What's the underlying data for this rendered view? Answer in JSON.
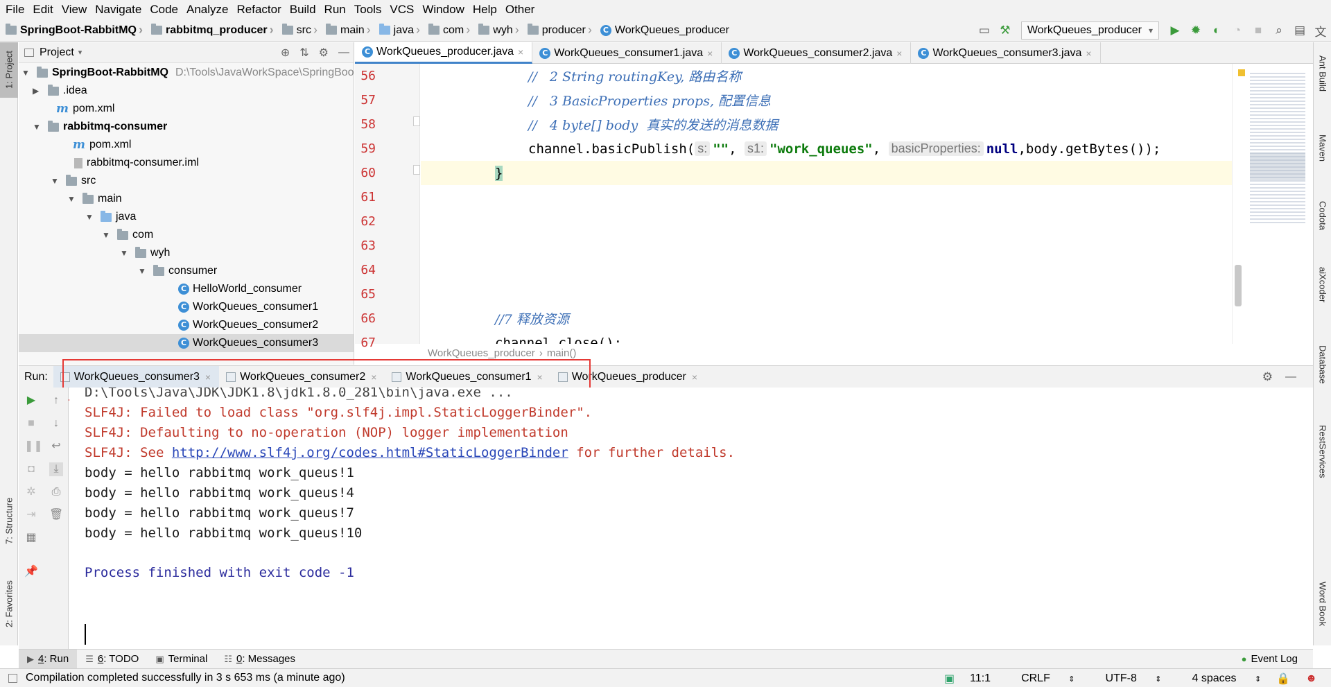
{
  "menu": [
    "File",
    "Edit",
    "View",
    "Navigate",
    "Code",
    "Analyze",
    "Refactor",
    "Build",
    "Run",
    "Tools",
    "VCS",
    "Window",
    "Help",
    "Other"
  ],
  "breadcrumb": [
    "SpringBoot-RabbitMQ",
    "rabbitmq_producer",
    "src",
    "main",
    "java",
    "com",
    "wyh",
    "producer",
    "WorkQueues_producer"
  ],
  "run_config": "WorkQueues_producer",
  "left_strip": {
    "project": "1: Project",
    "structure": "7: Structure",
    "favorites": "2: Favorites"
  },
  "right_strip": [
    "Ant Build",
    "Maven",
    "Codota",
    "aiXcoder",
    "Database",
    "RestServices",
    "Word Book"
  ],
  "project_panel": {
    "title": "Project",
    "tree": [
      {
        "label": "SpringBoot-RabbitMQ",
        "path": "D:\\Tools\\JavaWorkSpace\\SpringBoo"
      },
      {
        "label": ".idea"
      },
      {
        "label": "pom.xml"
      },
      {
        "label": "rabbitmq-consumer"
      },
      {
        "label": "pom.xml"
      },
      {
        "label": "rabbitmq-consumer.iml"
      },
      {
        "label": "src"
      },
      {
        "label": "main"
      },
      {
        "label": "java"
      },
      {
        "label": "com"
      },
      {
        "label": "wyh"
      },
      {
        "label": "consumer"
      },
      {
        "label": "HelloWorld_consumer"
      },
      {
        "label": "WorkQueues_consumer1"
      },
      {
        "label": "WorkQueues_consumer2"
      },
      {
        "label": "WorkQueues_consumer3"
      }
    ]
  },
  "editor_tabs": [
    "WorkQueues_producer.java",
    "WorkQueues_consumer1.java",
    "WorkQueues_consumer2.java",
    "WorkQueues_consumer3.java"
  ],
  "editor": {
    "line_numbers": [
      "56",
      "57",
      "58",
      "59",
      "60",
      "61",
      "62",
      "63",
      "64",
      "65",
      "66",
      "67"
    ],
    "l56": "//   2 String routingKey, 路由名称",
    "l57": "//   3 BasicProperties props, 配置信息",
    "l58": "//   4 byte[] body  真实的发送的消息数据",
    "l59_call": "channel.basicPublish(",
    "l59_hint_s": "s:",
    "l59_str1": "\"\"",
    "l59_comma1": ", ",
    "l59_hint_s1": "s1:",
    "l59_str2": "\"work_queues\"",
    "l59_comma2": ", ",
    "l59_hint_bp": "basicProperties:",
    "l59_null": "null",
    "l59_rest": ",body.getBytes());",
    "l60": "}",
    "l66": "//7 释放资源",
    "l67": "channel.close();",
    "breadcrumb_class": "WorkQueues_producer",
    "breadcrumb_sep": "›",
    "breadcrumb_method": "main()"
  },
  "run_panel": {
    "label": "Run:",
    "tabs": [
      "WorkQueues_consumer3",
      "WorkQueues_consumer2",
      "WorkQueues_consumer1",
      "WorkQueues_producer"
    ],
    "console": {
      "java_path": "D:\\Tools\\Java\\JDK\\JDK1.8\\jdk1.8.0_281\\bin\\java.exe ...",
      "slf1": "SLF4J: Failed to load class \"org.slf4j.impl.StaticLoggerBinder\".",
      "slf2": "SLF4J: Defaulting to no-operation (NOP) logger implementation",
      "slf3_pre": "SLF4J: See ",
      "slf3_link": "http://www.slf4j.org/codes.html#StaticLoggerBinder",
      "slf3_post": " for further details.",
      "bodies": [
        "body = hello rabbitmq work_queus!1",
        "body = hello rabbitmq work_queus!4",
        "body = hello rabbitmq work_queus!7",
        "body = hello rabbitmq work_queus!10"
      ],
      "exit": "Process finished with exit code -1"
    }
  },
  "bottom_tabs": [
    {
      "key": "4",
      "label": ": Run"
    },
    {
      "key": "6",
      "label": ": TODO"
    },
    {
      "key": "",
      "label": "Terminal"
    },
    {
      "key": "0",
      "label": ": Messages"
    }
  ],
  "event_log": "Event Log",
  "status": {
    "message": "Compilation completed successfully in 3 s 653 ms (a minute ago)",
    "position": "11:1",
    "line_sep": "CRLF",
    "encoding": "UTF-8",
    "indent": "4 spaces"
  },
  "colors": {
    "accent": "#4083c9",
    "highlight_box": "#e53935",
    "line_number": "#cc3333"
  }
}
